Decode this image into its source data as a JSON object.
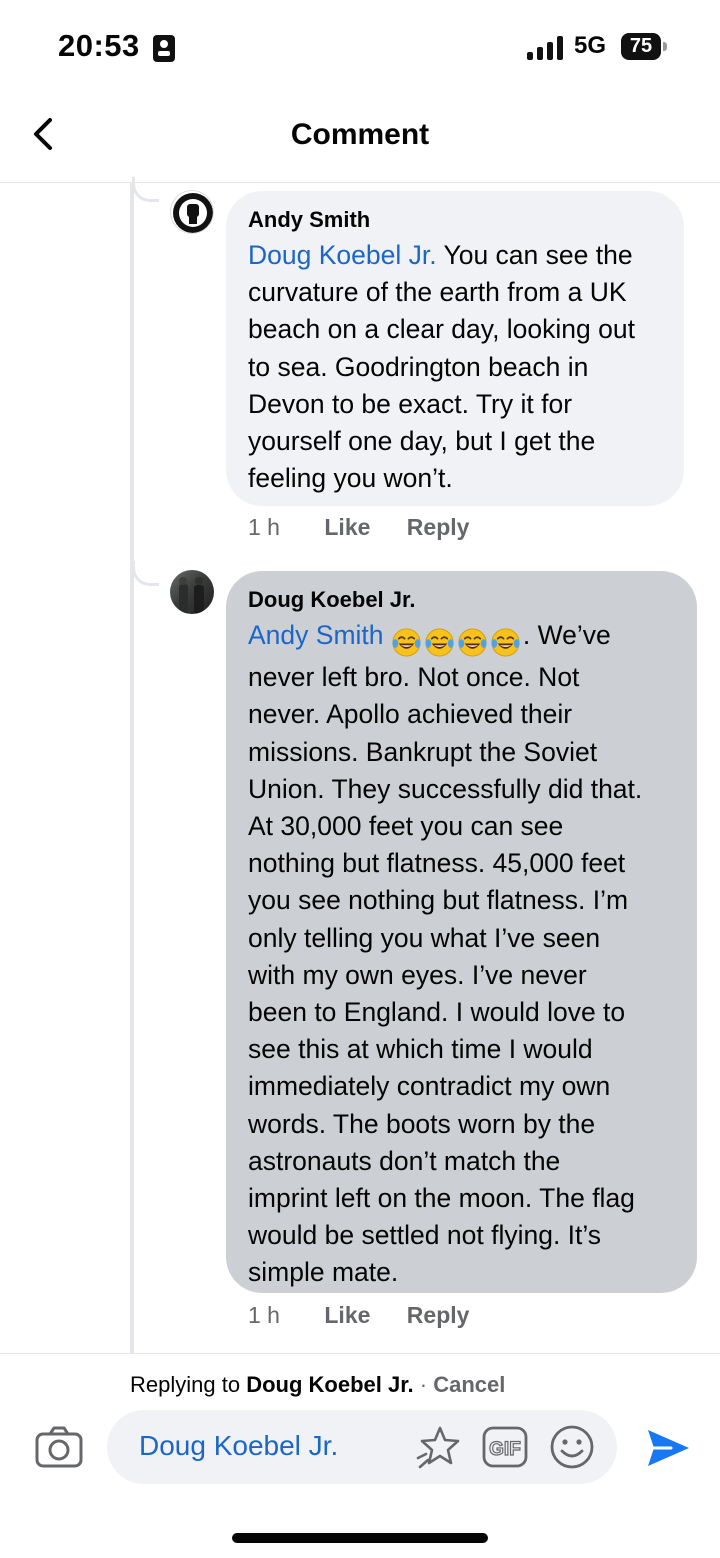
{
  "status_bar": {
    "time": "20:53",
    "network": "5G",
    "battery": "75"
  },
  "header": {
    "title": "Comment"
  },
  "comments": [
    {
      "author": "Andy Smith",
      "mention": "Doug Koebel Jr.",
      "text": " You can see the\ncurvature of the earth from a UK\nbeach on a clear day, looking out\nto sea. Goodrington beach in\nDevon to be exact. Try it for\nyourself one day, but I get the\nfeeling you won’t.",
      "time": "1 h",
      "like_label": "Like",
      "reply_label": "Reply"
    },
    {
      "author": "Doug Koebel Jr.",
      "mention": "Andy Smith",
      "emoji_count": 4,
      "emoji_name": "tears-of-joy",
      "text_first_line_tail": ". We’ve",
      "text": "never left bro. Not once. Not\nnever. Apollo achieved their\nmissions. Bankrupt the Soviet\nUnion. They successfully did that.\nAt 30,000 feet you can see\nnothing but flatness. 45,000 feet\nyou see nothing but flatness. I’m\nonly telling you what I’ve seen\nwith my own eyes. I’ve never\nbeen to England. I would love to\nsee this at which time I would\nimmediately contradict my own\nwords. The boots worn by the\nastronauts don’t match the\nimprint left on the moon. The flag\nwould be settled not flying. It’s\nsimple mate.",
      "time": "1 h",
      "like_label": "Like",
      "reply_label": "Reply"
    }
  ],
  "composer": {
    "replying_prefix": "Replying to ",
    "replying_to": "Doug Koebel Jr.",
    "separator": " · ",
    "cancel_label": "Cancel",
    "input_value": "Doug Koebel Jr."
  },
  "colors": {
    "mention": "#1b66c9",
    "send": "#1877f2",
    "bubble_light": "#f0f2f5",
    "bubble_selected": "#ccd0d5"
  },
  "icons": [
    "id-card-icon",
    "signal-icon",
    "battery-icon",
    "back-arrow-icon",
    "camera-icon",
    "avatar-sticker-icon",
    "gif-icon",
    "emoji-icon",
    "send-icon"
  ]
}
